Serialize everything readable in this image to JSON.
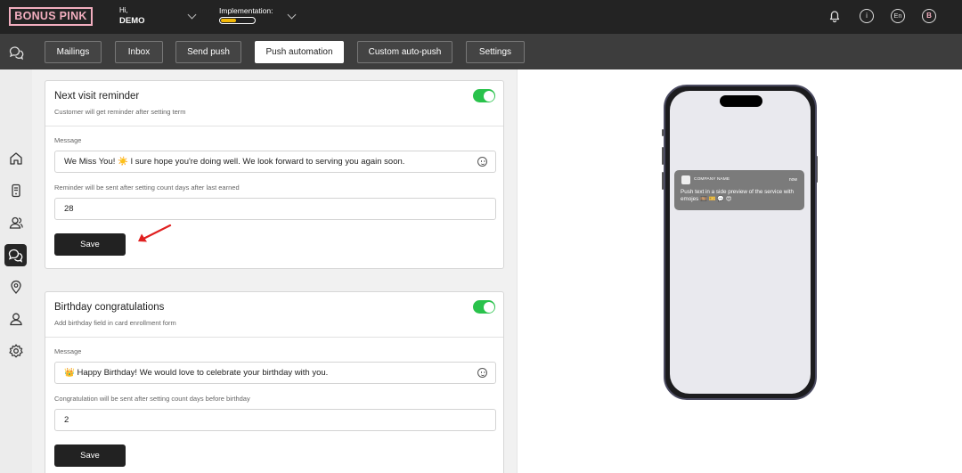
{
  "header": {
    "logo": "BONUS PINK",
    "greeting": "Hi,",
    "user": "DEMO",
    "implementation_label": "Implementation:",
    "implementation_progress": 0.45,
    "language": "En",
    "avatar_initial": "B",
    "info_icon_text": "i"
  },
  "nav": {
    "tabs": [
      {
        "label": "Mailings",
        "active": false
      },
      {
        "label": "Inbox",
        "active": false
      },
      {
        "label": "Send push",
        "active": false
      },
      {
        "label": "Push automation",
        "active": true
      },
      {
        "label": "Custom auto-push",
        "active": false
      },
      {
        "label": "Settings",
        "active": false
      }
    ]
  },
  "sidebar": {
    "items": [
      "home-icon",
      "phone-card-icon",
      "users-icon",
      "chat-icon",
      "location-icon",
      "user-icon",
      "gear-icon"
    ],
    "active": "chat-icon"
  },
  "cards": [
    {
      "title": "Next visit reminder",
      "subtitle": "Customer will get reminder after setting term",
      "enabled": true,
      "message_label": "Message",
      "message_value": "We Miss You! ☀️ I sure hope you're doing well.  We look forward to serving you again soon.",
      "count_label": "Reminder will be sent after setting count days after last earned",
      "count_value": "28",
      "save_label": "Save"
    },
    {
      "title": "Birthday congratulations",
      "subtitle": "Add birthday field in card enrollment form",
      "enabled": true,
      "message_label": "Message",
      "message_value": "👑 Happy Birthday!  We would love to celebrate your birthday with you.",
      "count_label": "Congratulation will be sent after setting count days before birthday",
      "count_value": "2",
      "save_label": "Save"
    }
  ],
  "preview": {
    "app_name": "COMPANY NAME",
    "time": "now",
    "body": "Push text in a side preview of the service with emojes 🎞️ 🎫 💬 😍"
  },
  "colors": {
    "brand": "#f2aebf",
    "toggle_on": "#29c24b",
    "progress": "#f2b705",
    "arrow": "#e02020"
  }
}
